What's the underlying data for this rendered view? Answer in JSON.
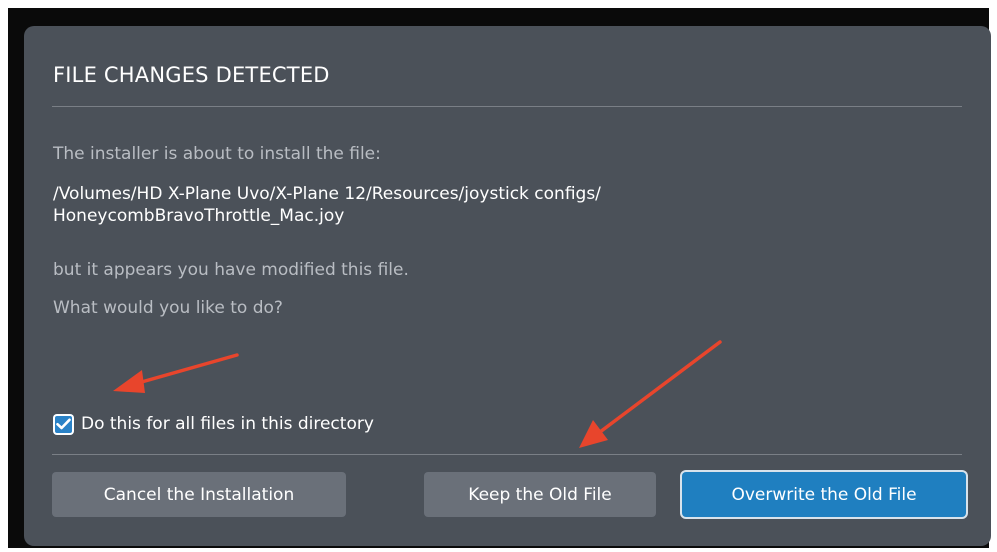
{
  "dialog": {
    "title": "FILE CHANGES DETECTED",
    "intro": "The installer is about to install the file:",
    "path_line1": "/Volumes/HD X-Plane Uvo/X-Plane 12/Resources/joystick configs/",
    "path_line2": "HoneycombBravoThrottle_Mac.joy",
    "modified_notice": "but it appears you have modified this file.",
    "question": "What would you like to do?"
  },
  "option": {
    "apply_all_label": "Do this for all files in this directory",
    "apply_all_checked": true
  },
  "buttons": {
    "cancel_label": "Cancel the Installation",
    "keep_label": "Keep the Old File",
    "overwrite_label": "Overwrite the Old File"
  },
  "colors": {
    "dialog_bg": "#4b5159",
    "button_bg": "#6a7079",
    "primary_button_bg": "#1f7fc0",
    "annotation_arrow": "#e8452c"
  },
  "icons": {
    "checkbox": "check-icon"
  }
}
